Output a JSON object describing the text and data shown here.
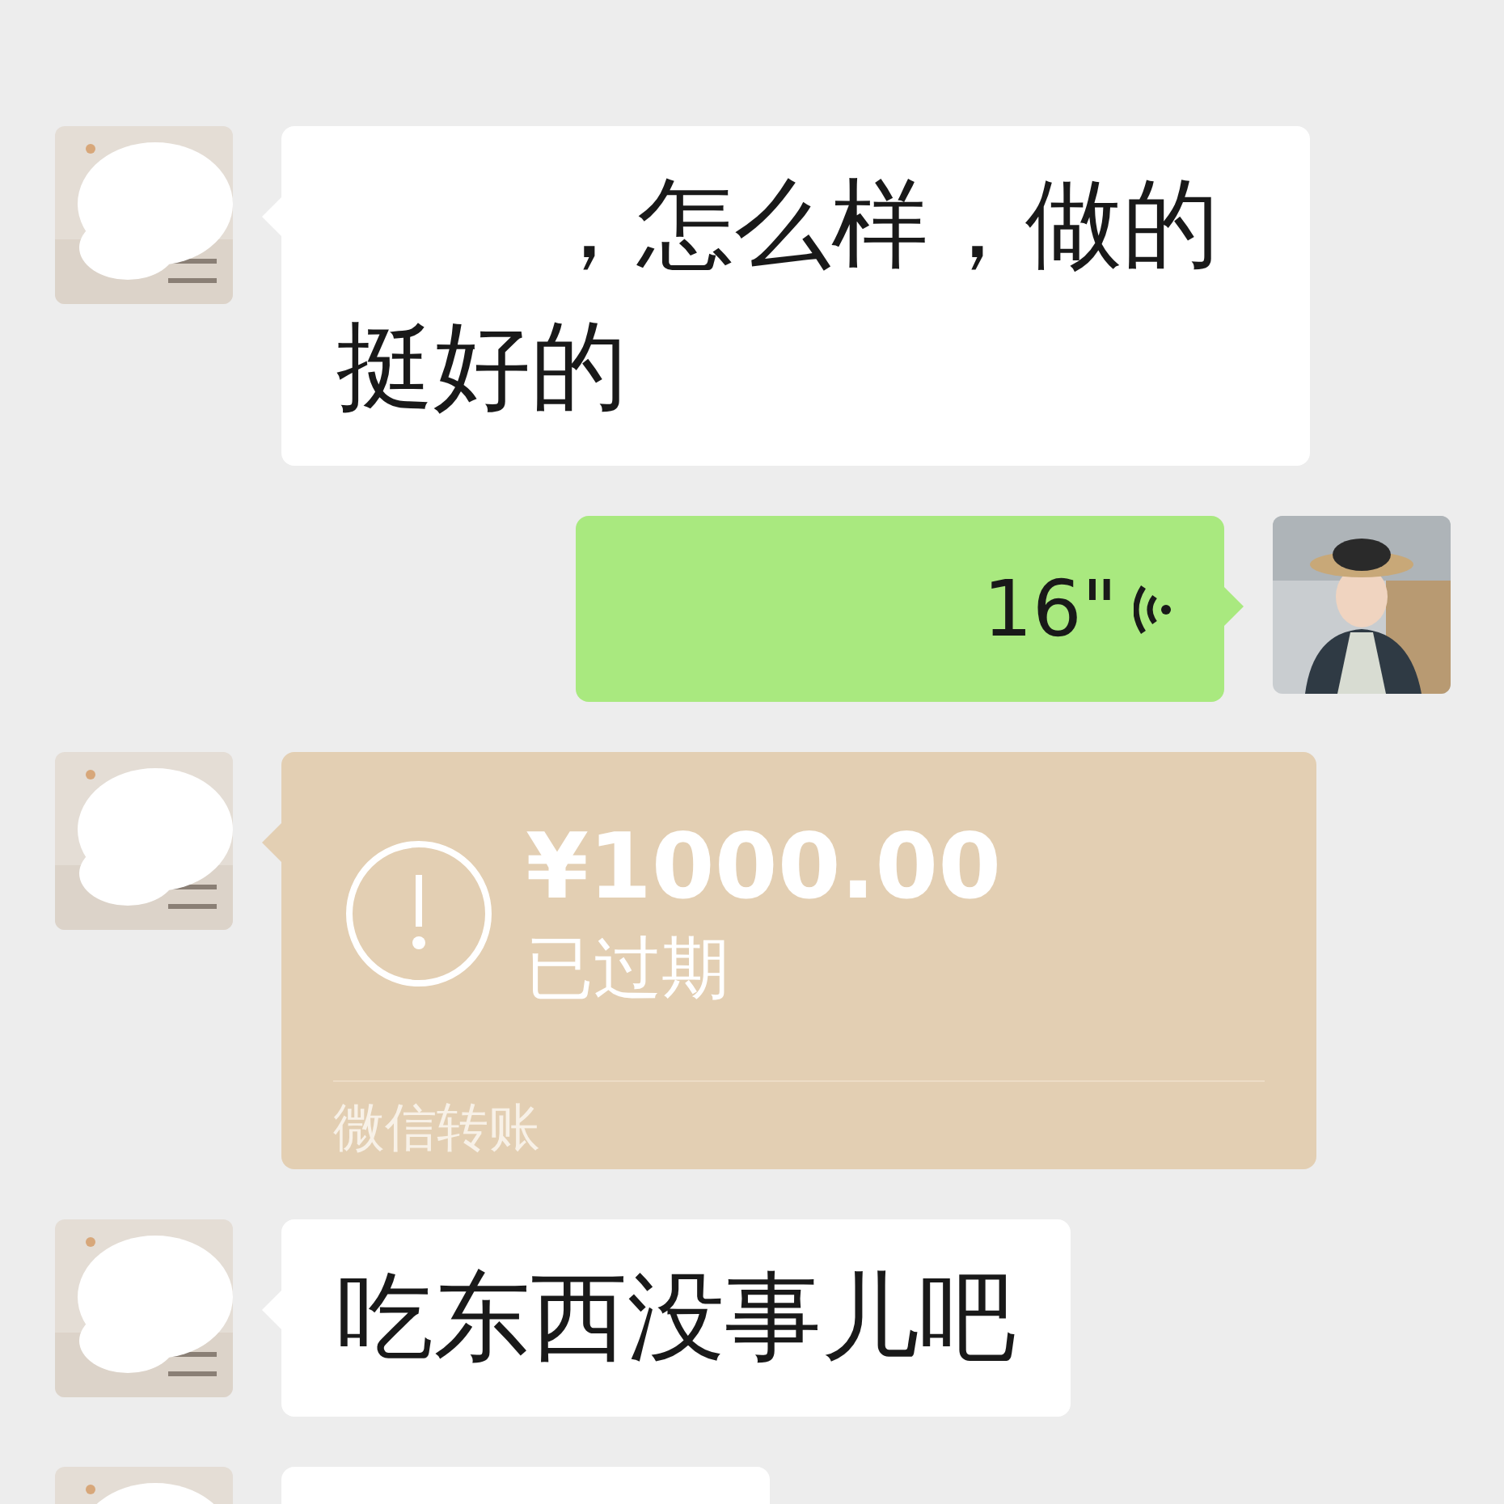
{
  "messages": [
    {
      "kind": "text",
      "mine": false,
      "text": "，怎么样，做的挺好的"
    },
    {
      "kind": "voice",
      "mine": true,
      "duration": "16\""
    },
    {
      "kind": "transfer",
      "mine": false,
      "amount": "¥1000.00",
      "status": "已过期",
      "label": "微信转账"
    },
    {
      "kind": "text",
      "mine": false,
      "text": "吃东西没事儿吧"
    },
    {
      "kind": "cut",
      "mine": false
    }
  ]
}
